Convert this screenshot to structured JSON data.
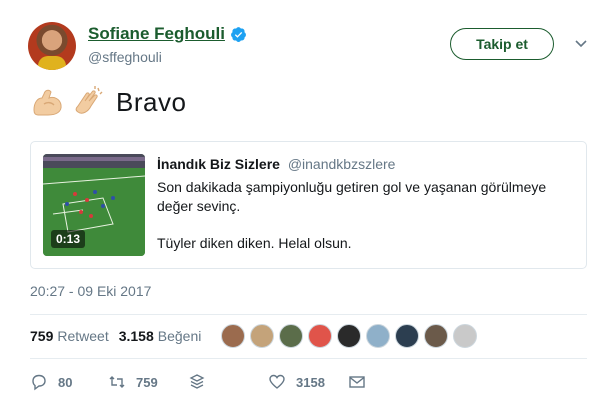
{
  "user": {
    "display_name": "Sofiane Feghouli",
    "handle": "@sffeghouli",
    "follow_label": "Takip et"
  },
  "tweet": {
    "emojis": [
      "flexed-biceps-emoji",
      "clapping-hands-emoji"
    ],
    "text": "Bravo"
  },
  "quote": {
    "author_name": "İnandık Biz Sizlere",
    "author_handle": "@inandkbzszlere",
    "video_duration": "0:13",
    "lines": [
      "Son dakikada şampiyonluğu getiren gol ve yaşanan görülmeye değer sevinç.",
      "Tüyler diken diken. Helal olsun."
    ]
  },
  "timestamp": "20:27 - 09 Eki 2017",
  "stats": {
    "retweets": "759",
    "retweets_label": "Retweet",
    "likes": "3.158",
    "likes_label": "Beğeni",
    "liker_colors": [
      "#9b6b4e",
      "#c4a37a",
      "#5b6d4a",
      "#e0544a",
      "#2a2a2a",
      "#8fb0c9",
      "#2c3e50",
      "#6b5a4a",
      "#c9c9c9"
    ]
  },
  "actions": {
    "reply_count": "80",
    "retweet_count": "759",
    "like_count": "3158"
  },
  "colors": {
    "accent": "#1b5c2e",
    "secondary_text": "#657786",
    "verified": "#1da1f2"
  }
}
